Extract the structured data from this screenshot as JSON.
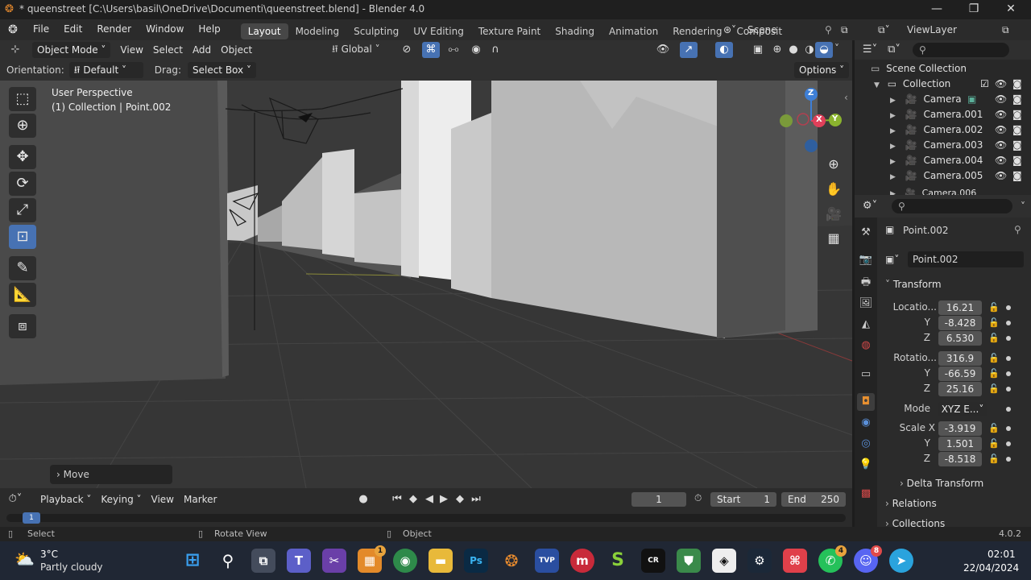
{
  "window": {
    "title": "* queenstreet [C:\\Users\\basil\\OneDrive\\Documenti\\queenstreet.blend] - Blender 4.0",
    "minimize": "—",
    "maximize": "❐",
    "close": "✕"
  },
  "menubar": {
    "items": [
      "File",
      "Edit",
      "Render",
      "Window",
      "Help"
    ],
    "workspaces": [
      "Layout",
      "Modeling",
      "Sculpting",
      "UV Editing",
      "Texture Paint",
      "Shading",
      "Animation",
      "Rendering",
      "Compositing"
    ],
    "active_workspace": "Layout",
    "scene_label": "Scene",
    "viewlayer_label": "ViewLayer"
  },
  "viewport_header": {
    "mode": "Object Mode",
    "menus": [
      "View",
      "Select",
      "Add",
      "Object"
    ],
    "transform_orientation": "Global",
    "orientation_label": "Orientation:",
    "orientation_value": "Default",
    "drag_label": "Drag:",
    "drag_value": "Select Box",
    "options": "Options"
  },
  "viewport": {
    "perspective_label": "User Perspective",
    "collection_label": "(1) Collection | Point.002",
    "last_operator": "Move",
    "gizmo_axes": {
      "z": "Z",
      "x": "X",
      "y": "Y"
    },
    "colors": {
      "x": "#e0405a",
      "y": "#8ab32e",
      "z": "#3e7fd6"
    }
  },
  "timeline": {
    "menus": [
      "Playback",
      "Keying",
      "View",
      "Marker"
    ],
    "current_frame": "1",
    "start_label": "Start",
    "start_value": "1",
    "end_label": "End",
    "end_value": "250",
    "ruler_marker": "1"
  },
  "statusbar": {
    "select": "Select",
    "rotate_view": "Rotate View",
    "object": "Object",
    "version": "4.0.2"
  },
  "outliner": {
    "scene_collection": "Scene Collection",
    "collection": "Collection",
    "items": [
      "Camera",
      "Camera.001",
      "Camera.002",
      "Camera.003",
      "Camera.004",
      "Camera.005",
      "Camera.006"
    ]
  },
  "properties": {
    "object_name": "Point.002",
    "data_name": "Point.002",
    "transform_header": "Transform",
    "location_label": "Locatio...",
    "location": [
      "16.21",
      "-8.428",
      "6.530"
    ],
    "rotation_label": "Rotatio...",
    "rotation": [
      "316.9",
      "-66.59",
      "25.16"
    ],
    "mode_label": "Mode",
    "mode_value": "XYZ E...",
    "scale_label": "Scale X",
    "scale": [
      "-3.919",
      "1.501",
      "-8.518"
    ],
    "axis_y": "Y",
    "axis_z": "Z",
    "delta_transform": "Delta Transform",
    "relations": "Relations",
    "collections": "Collections"
  },
  "taskbar": {
    "weather_temp": "3°C",
    "weather_desc": "Partly cloudy",
    "time": "02:01",
    "date": "22/04/2024",
    "badge_notes": "1",
    "badge_whatsapp": "4",
    "badge_discord": "8"
  }
}
